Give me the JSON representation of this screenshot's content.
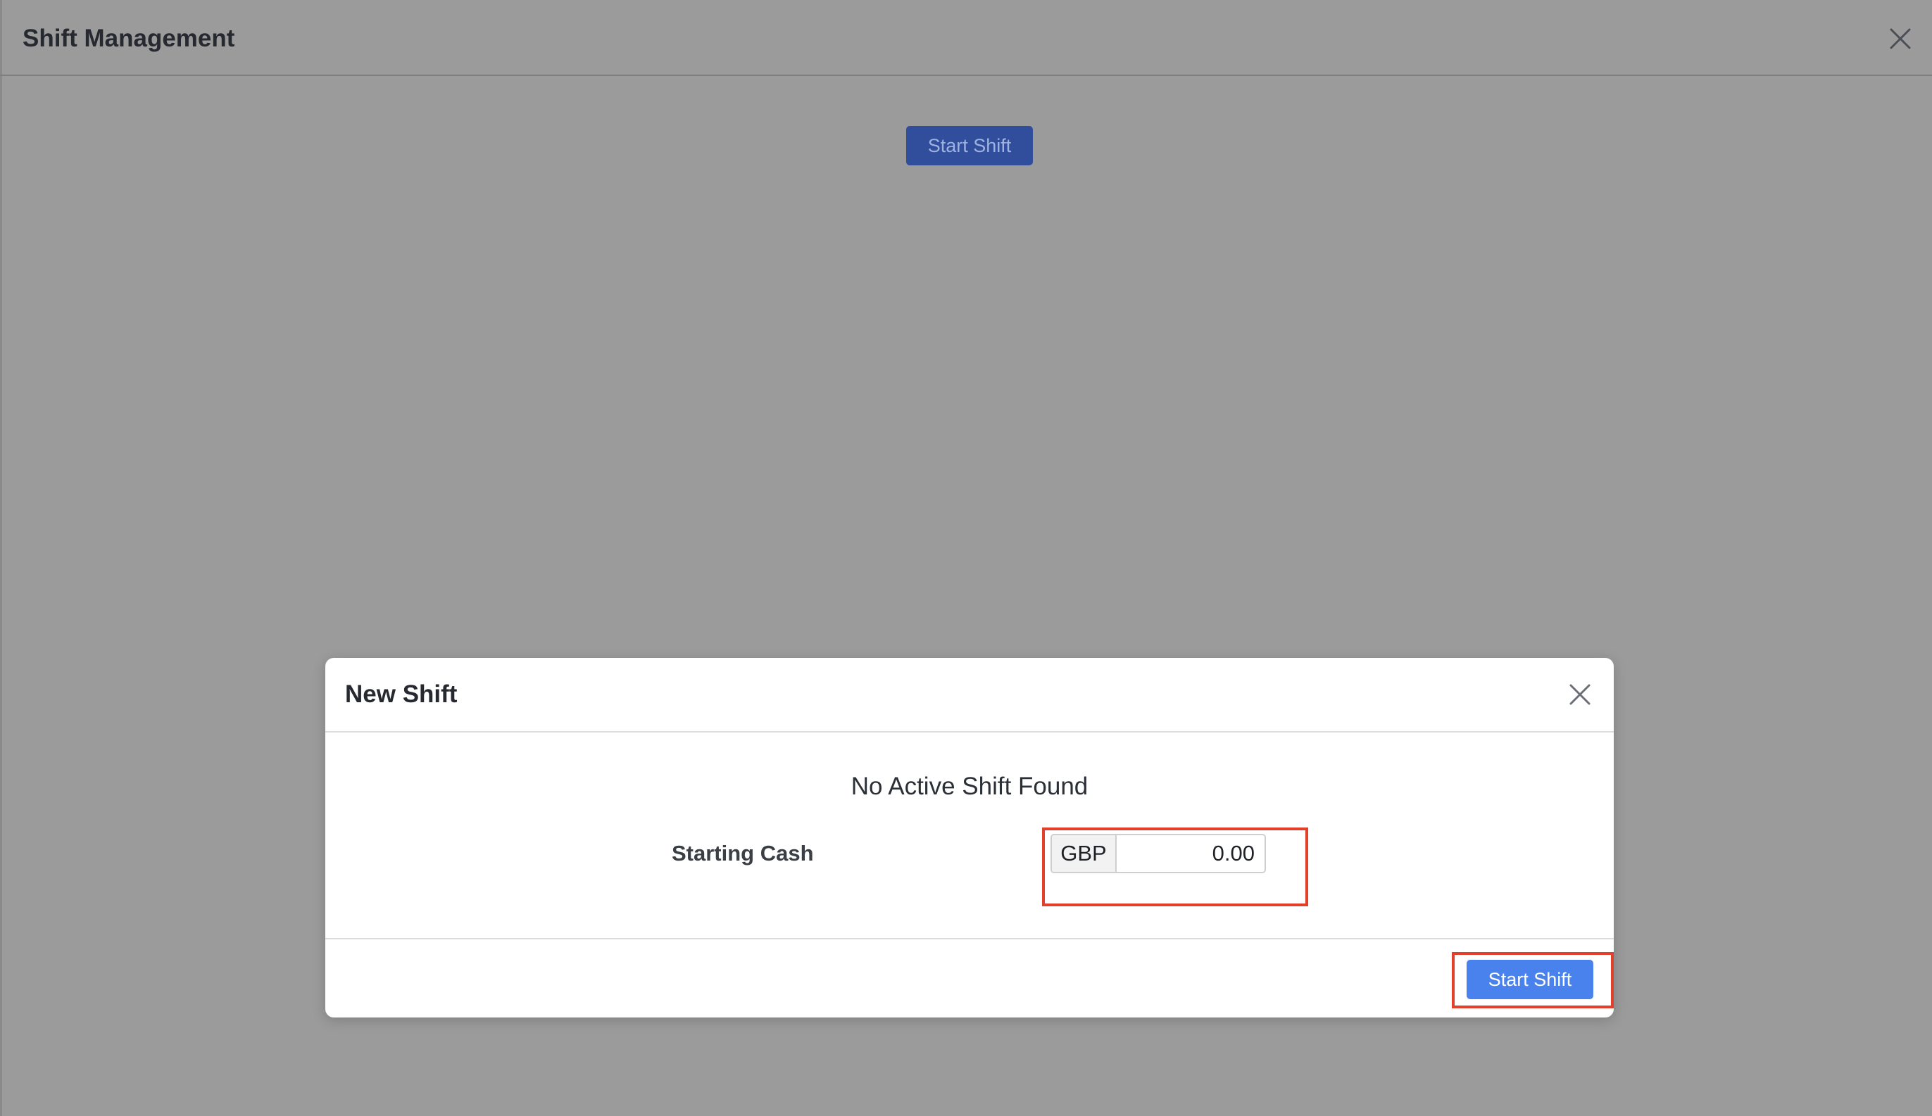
{
  "background_page": {
    "title": "Shift Management",
    "close_icon": "close-icon",
    "start_button_label": "Start Shift"
  },
  "modal": {
    "title": "New Shift",
    "close_icon": "close-icon",
    "message": "No Active Shift Found",
    "starting_cash_label": "Starting Cash",
    "currency": "GBP",
    "starting_cash_value": "0.00",
    "start_button_label": "Start Shift"
  },
  "colors": {
    "overlay_background": "#9b9b9b",
    "primary_button": "#4a82ed",
    "dimmed_primary_button": "#304e9c",
    "highlight_border": "#e2402b"
  }
}
